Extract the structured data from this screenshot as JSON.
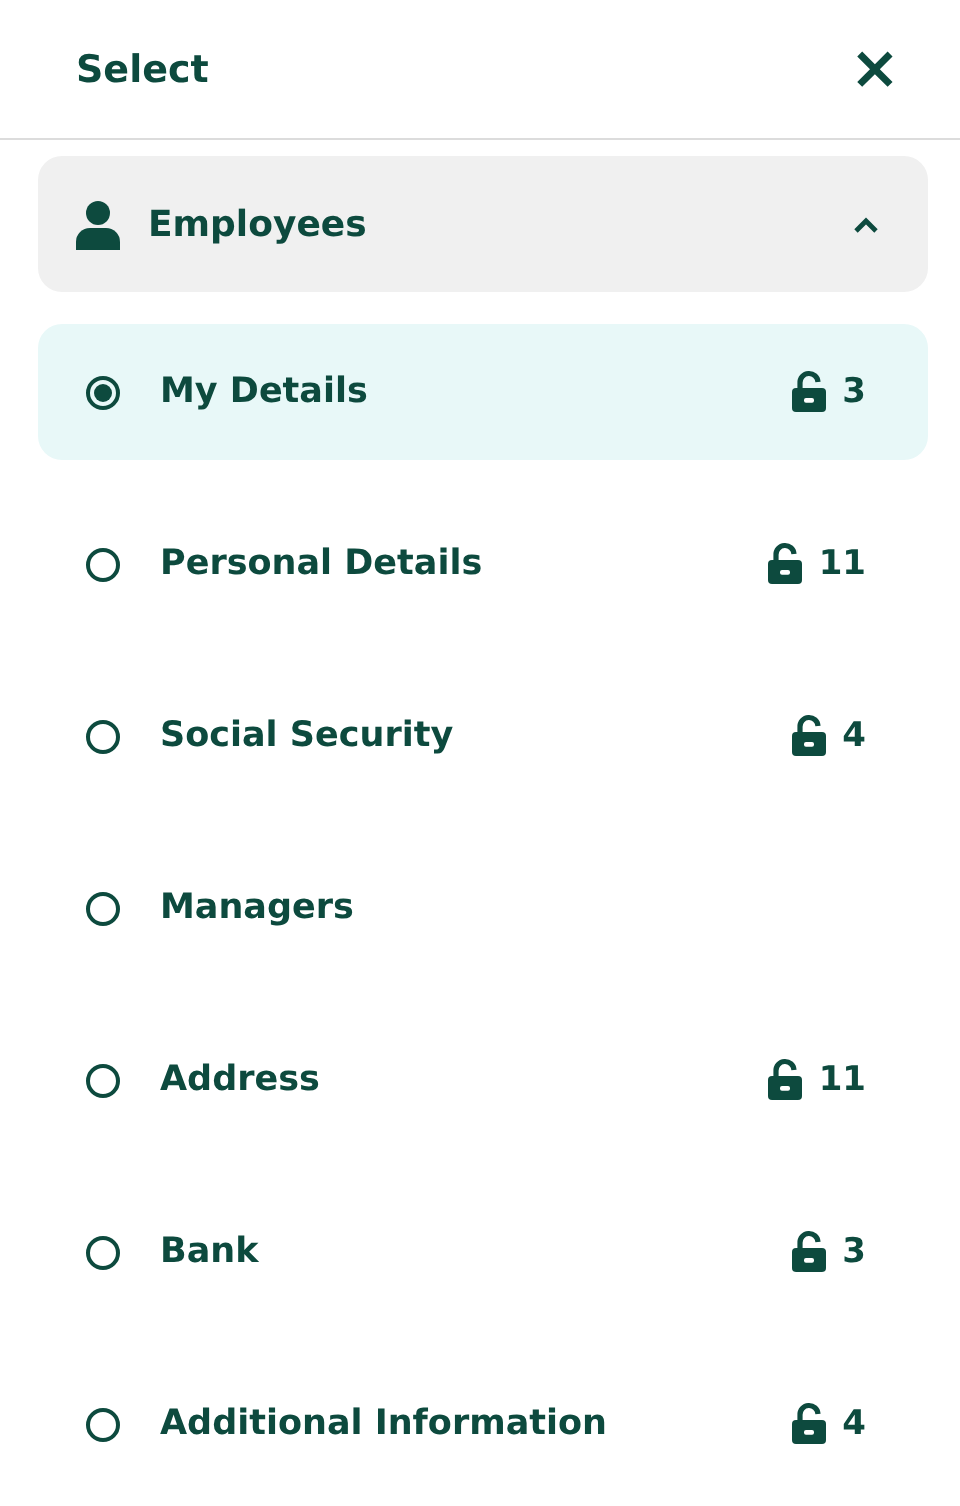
{
  "header": {
    "title": "Select",
    "close": "×"
  },
  "group": {
    "label": "Employees",
    "expanded": true,
    "items": [
      {
        "label": "My Details",
        "selected": true,
        "count": "3"
      },
      {
        "label": "Personal Details",
        "selected": false,
        "count": "11"
      },
      {
        "label": "Social Security",
        "selected": false,
        "count": "4"
      },
      {
        "label": "Managers",
        "selected": false
      },
      {
        "label": "Address",
        "selected": false,
        "count": "11"
      },
      {
        "label": "Bank",
        "selected": false,
        "count": "3"
      },
      {
        "label": "Additional Information",
        "selected": false,
        "count": "4"
      }
    ]
  }
}
